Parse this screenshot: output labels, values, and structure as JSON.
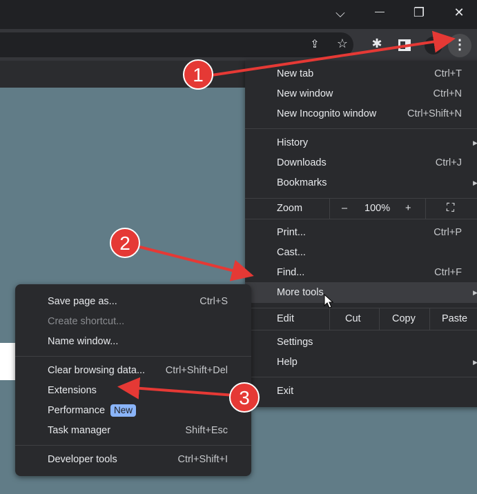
{
  "window_controls": {
    "tabsearch": "⌵",
    "minimize": "—",
    "maximize": "❐",
    "close": "✕"
  },
  "toolbar": {
    "share_icon": "share-icon",
    "bookmark_icon": "☆",
    "extensions_icon": "extensions-icon",
    "sidepanel_icon": "side-panel-icon",
    "profile_icon": "profile-icon",
    "menu_icon": "⋮"
  },
  "main_menu": {
    "new_tab": {
      "label": "New tab",
      "shortcut": "Ctrl+T"
    },
    "new_window": {
      "label": "New window",
      "shortcut": "Ctrl+N"
    },
    "incognito": {
      "label": "New Incognito window",
      "shortcut": "Ctrl+Shift+N"
    },
    "history": {
      "label": "History"
    },
    "downloads": {
      "label": "Downloads",
      "shortcut": "Ctrl+J"
    },
    "bookmarks": {
      "label": "Bookmarks"
    },
    "zoom": {
      "label": "Zoom",
      "minus": "–",
      "value": "100%",
      "plus": "+"
    },
    "print": {
      "label": "Print...",
      "shortcut": "Ctrl+P"
    },
    "cast": {
      "label": "Cast..."
    },
    "find": {
      "label": "Find...",
      "shortcut": "Ctrl+F"
    },
    "more_tools": {
      "label": "More tools"
    },
    "edit": {
      "label": "Edit",
      "cut": "Cut",
      "copy": "Copy",
      "paste": "Paste"
    },
    "settings": {
      "label": "Settings"
    },
    "help": {
      "label": "Help"
    },
    "exit": {
      "label": "Exit"
    }
  },
  "sub_menu": {
    "save": {
      "label": "Save page as...",
      "shortcut": "Ctrl+S"
    },
    "shortcut": {
      "label": "Create shortcut..."
    },
    "name_window": {
      "label": "Name window..."
    },
    "clear": {
      "label": "Clear browsing data...",
      "shortcut": "Ctrl+Shift+Del"
    },
    "extensions": {
      "label": "Extensions"
    },
    "performance": {
      "label": "Performance",
      "badge": "New"
    },
    "task_manager": {
      "label": "Task manager",
      "shortcut": "Shift+Esc"
    },
    "devtools": {
      "label": "Developer tools",
      "shortcut": "Ctrl+Shift+I"
    }
  },
  "annotations": {
    "step1": "1",
    "step2": "2",
    "step3": "3",
    "color": "#e53935"
  }
}
